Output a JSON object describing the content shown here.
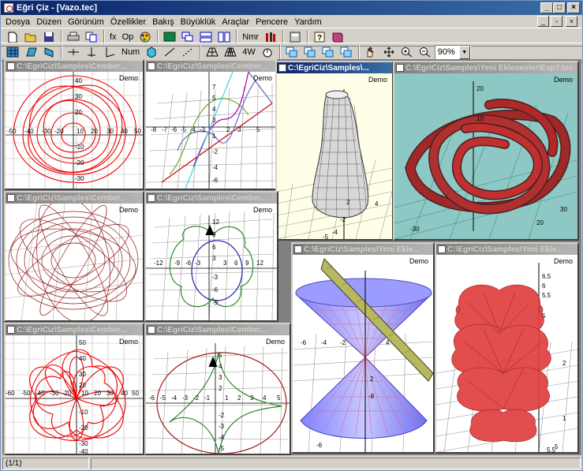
{
  "window": {
    "title": "Eğri Çiz - [Vazo.tec]"
  },
  "menu": [
    {
      "label": "Dosya",
      "key": "D"
    },
    {
      "label": "Düzen",
      "key": "z"
    },
    {
      "label": "Görünüm",
      "key": "G"
    },
    {
      "label": "Özellikler",
      "key": "Ö"
    },
    {
      "label": "Bakış",
      "key": "B"
    },
    {
      "label": "Büyüklük",
      "key": "ü"
    },
    {
      "label": "Araçlar",
      "key": "A"
    },
    {
      "label": "Pencere",
      "key": "P"
    },
    {
      "label": "Yardım",
      "key": "Y"
    }
  ],
  "toolbar1": {
    "fx": "fx",
    "op": "Op",
    "nmr": "Nmr"
  },
  "toolbar2": {
    "num": "Num",
    "fw": "4W",
    "zoom": "90%"
  },
  "windows": [
    {
      "title": "C:\\EgriCiz\\Samples\\Cember...",
      "demo": "Demo"
    },
    {
      "title": "C:\\EgriCiz\\Samples\\Cember...",
      "demo": "Demo"
    },
    {
      "title": "C:\\EgriCiz\\Samples\\...",
      "demo": "Demo"
    },
    {
      "title": "C:\\EgriCiz\\Samples\\Yeni Eklenenler\\Exp7.tec",
      "demo": "Demo"
    },
    {
      "title": "C:\\EgriCiz\\Samples\\Cember...",
      "demo": "Demo"
    },
    {
      "title": "C:\\EgriCiz\\Samples\\Cember...",
      "demo": "Demo"
    },
    {
      "title": "C:\\EgriCiz\\Samples\\Yeni Ekle...",
      "demo": "Demo"
    },
    {
      "title": "C:\\EgriCiz\\Samples\\Yeni Ekle...",
      "demo": "Demo"
    },
    {
      "title": "C:\\EgriCiz\\Samples\\Cember...",
      "demo": "Demo"
    },
    {
      "title": "C:\\EgriCiz\\Samples\\Cember...",
      "demo": "Demo"
    }
  ],
  "status": {
    "page": "(1/1)"
  }
}
